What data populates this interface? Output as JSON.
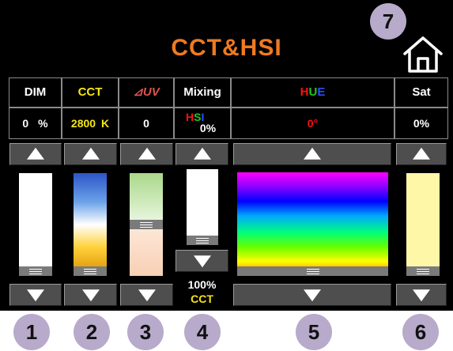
{
  "title": "CCT&HSI",
  "colors": {
    "accent": "#f07a1f",
    "cct": "#f5e614",
    "uv": "#d9534f",
    "badge": "#b7aacb"
  },
  "home_icon": "home-icon",
  "columns": {
    "dim": {
      "label": "DIM",
      "value": "0",
      "unit": "%",
      "level": 0.0
    },
    "cct": {
      "label": "CCT",
      "value": "2800",
      "unit": "K",
      "level": 0.0
    },
    "uv": {
      "label": "⊿UV",
      "value": "0",
      "level": 0.5
    },
    "mixing": {
      "label": "Mixing",
      "hsi_label": "HSI",
      "hsi_value": "0%",
      "cct_value": "100%",
      "cct_label": "CCT",
      "level": 0.0
    },
    "hue": {
      "label": "HUE",
      "value": "0°",
      "level": 0.0
    },
    "sat": {
      "label": "Sat",
      "value": "0%",
      "level": 0.0
    }
  },
  "badges": [
    "1",
    "2",
    "3",
    "4",
    "5",
    "6",
    "7"
  ]
}
